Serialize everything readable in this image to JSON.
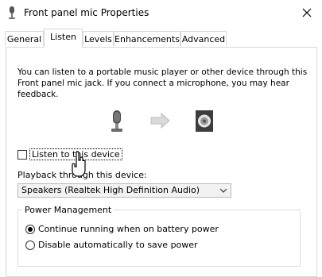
{
  "window": {
    "title": "Front panel mic Properties"
  },
  "tabs": [
    {
      "label": "General"
    },
    {
      "label": "Listen"
    },
    {
      "label": "Levels"
    },
    {
      "label": "Enhancements"
    },
    {
      "label": "Advanced"
    }
  ],
  "active_tab": "Listen",
  "listen": {
    "description": "You can listen to a portable music player or other device through this Front panel mic jack.  If you connect a microphone, you may hear feedback.",
    "checkbox_label": "Listen to this device",
    "checkbox_checked": false,
    "playback_label": "Playback through this device:",
    "playback_selected": "Speakers (Realtek High Definition Audio)"
  },
  "power": {
    "group_title": "Power Management",
    "options": [
      {
        "label": "Continue running when on battery power",
        "checked": true
      },
      {
        "label": "Disable automatically to save power",
        "checked": false
      }
    ]
  },
  "icons": [
    "microphone-icon",
    "arrow-right-icon",
    "speaker-icon",
    "close-icon",
    "mouse-cursor-icon"
  ]
}
